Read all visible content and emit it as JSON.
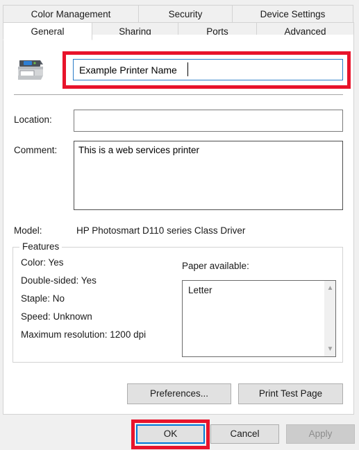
{
  "dialog": {
    "tabs_row_top": [
      {
        "label": "Color Management",
        "selected": false
      },
      {
        "label": "Security",
        "selected": false
      },
      {
        "label": "Device Settings",
        "selected": false
      }
    ],
    "tabs_row_bottom": [
      {
        "label": "General",
        "selected": true
      },
      {
        "label": "Sharing",
        "selected": false
      },
      {
        "label": "Ports",
        "selected": false
      },
      {
        "label": "Advanced",
        "selected": false
      }
    ]
  },
  "general": {
    "printer_icon": "printer-icon",
    "printer_name": "Example Printer Name",
    "location_label": "Location:",
    "location_value": "",
    "comment_label": "Comment:",
    "comment_value": "This is a web services printer",
    "model_label": "Model:",
    "model_value": "HP Photosmart D110 series Class Driver"
  },
  "features": {
    "legend": "Features",
    "items": [
      "Color: Yes",
      "Double-sided: Yes",
      "Staple: No",
      "Speed: Unknown",
      "Maximum resolution: 1200 dpi"
    ],
    "paper_label": "Paper available:",
    "paper_items": [
      "Letter"
    ],
    "scroll_up_icon": "chevron-up-icon",
    "scroll_down_icon": "chevron-down-icon"
  },
  "actions": {
    "preferences": "Preferences...",
    "print_test_page": "Print Test Page"
  },
  "footer": {
    "ok": "OK",
    "cancel": "Cancel",
    "apply": "Apply",
    "apply_disabled": true
  },
  "annotations": {
    "color": "#e8132b",
    "highlight_name_field": true,
    "highlight_ok_button": true
  },
  "colors": {
    "focus_blue": "#0078d7",
    "input_focus_border": "#2a7cc7",
    "dialog_bg": "#f0f0f0",
    "page_bg": "#ffffff",
    "button_bg": "#e1e1e1",
    "disabled_text": "#8d8d8d"
  }
}
